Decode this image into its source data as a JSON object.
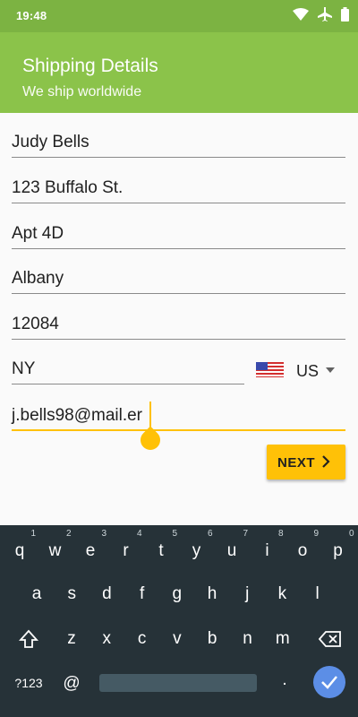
{
  "status_bar": {
    "time": "19:48"
  },
  "app_bar": {
    "title": "Shipping Details",
    "subtitle": "We ship worldwide"
  },
  "form": {
    "name": "Judy Bells",
    "address1": "123 Buffalo St.",
    "address2": "Apt 4D",
    "city": "Albany",
    "zip": "12084",
    "state": "NY",
    "country_code": "US",
    "email": "j.bells98@mail.er"
  },
  "next_button": {
    "label": "NEXT"
  },
  "keyboard": {
    "row1": [
      {
        "k": "q",
        "h": "1"
      },
      {
        "k": "w",
        "h": "2"
      },
      {
        "k": "e",
        "h": "3"
      },
      {
        "k": "r",
        "h": "4"
      },
      {
        "k": "t",
        "h": "5"
      },
      {
        "k": "y",
        "h": "6"
      },
      {
        "k": "u",
        "h": "7"
      },
      {
        "k": "i",
        "h": "8"
      },
      {
        "k": "o",
        "h": "9"
      },
      {
        "k": "p",
        "h": "0"
      }
    ],
    "row2": [
      "a",
      "s",
      "d",
      "f",
      "g",
      "h",
      "j",
      "k",
      "l"
    ],
    "row3": [
      "z",
      "x",
      "c",
      "v",
      "b",
      "n",
      "m"
    ],
    "symbols_key": "?123",
    "at_key": "@",
    "period_key": "."
  },
  "colors": {
    "primary": "#8bc34a",
    "status_bar": "#7cb342",
    "accent": "#ffc107",
    "keyboard_bg": "#263238",
    "enter": "#5c8ee6"
  },
  "icons": [
    "wifi-icon",
    "airplane-icon",
    "battery-icon",
    "flag-icon",
    "dropdown-icon",
    "chevron-right-icon",
    "shift-icon",
    "backspace-icon",
    "check-icon"
  ]
}
